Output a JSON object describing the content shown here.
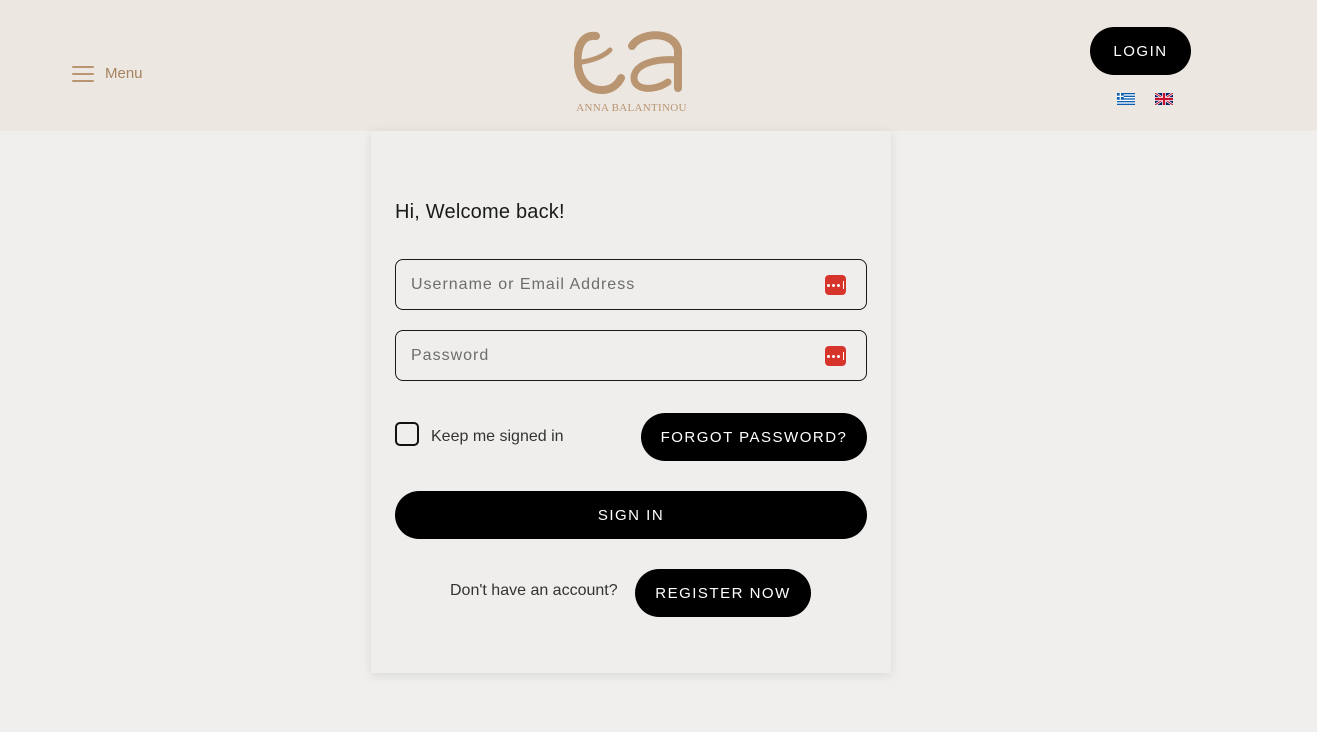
{
  "header": {
    "menu_label": "Menu",
    "logo_text": "ANNA BALANTINOU",
    "login_label": "LOGIN",
    "languages": [
      "Greek",
      "English"
    ]
  },
  "form": {
    "welcome": "Hi, Welcome back!",
    "username_placeholder": "Username or Email Address",
    "password_placeholder": "Password",
    "keep_signed_in": "Keep me signed in",
    "forgot_password": "FORGOT PASSWORD?",
    "sign_in": "SIGN IN",
    "no_account": "Don't have an account?",
    "register": "REGISTER NOW"
  },
  "colors": {
    "header_bg": "#ede7e2",
    "page_bg": "#f0efed",
    "accent_gold": "#b99572",
    "button_bg": "#000000",
    "password_manager_red": "#d7352c"
  },
  "icons": {
    "menu": "hamburger-icon",
    "password_manager": "password-manager-icon",
    "flag_gr": "greek-flag-icon",
    "flag_en": "uk-flag-icon"
  }
}
